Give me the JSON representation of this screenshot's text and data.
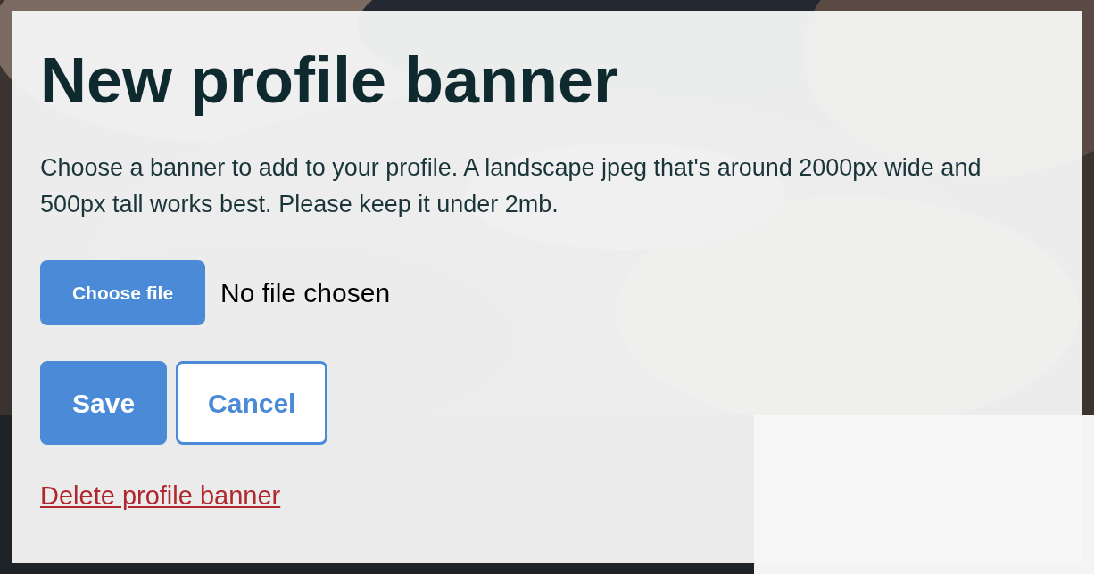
{
  "dialog": {
    "title": "New profile banner",
    "description": "Choose a banner to add to your profile. A landscape jpeg that's around 2000px wide and 500px tall works best. Please keep it under 2mb.",
    "file_input": {
      "button": "Choose file",
      "status": "No file chosen"
    },
    "buttons": [
      {
        "label": "Save",
        "kind": "primary"
      },
      {
        "label": "Cancel",
        "kind": "secondary"
      }
    ],
    "delete_link": "Delete profile banner"
  }
}
